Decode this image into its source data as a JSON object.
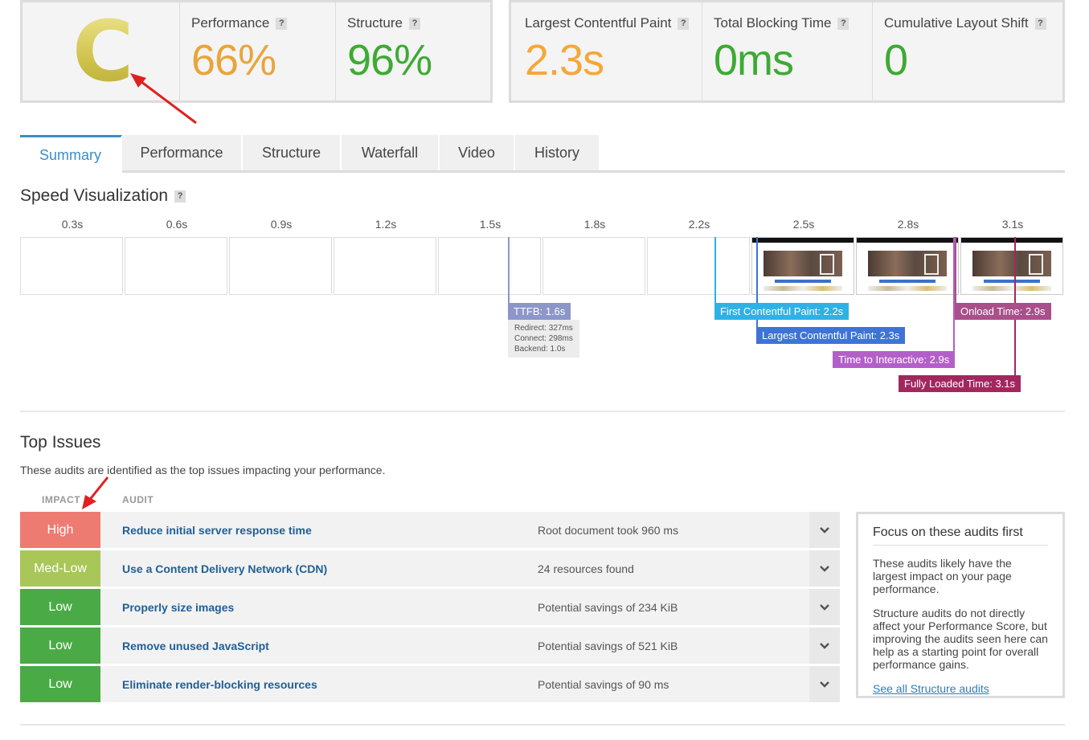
{
  "grade": {
    "letter": "C"
  },
  "scores": [
    {
      "label": "Performance",
      "help": "?",
      "value": "66%",
      "color": "#e8a53b"
    },
    {
      "label": "Structure",
      "help": "?",
      "value": "96%",
      "color": "#3eaa34"
    }
  ],
  "vitals": [
    {
      "label": "Largest Contentful Paint",
      "help": "?",
      "value": "2.3s",
      "color": "#f5a73a"
    },
    {
      "label": "Total Blocking Time",
      "help": "?",
      "value": "0ms",
      "color": "#3eaa34"
    },
    {
      "label": "Cumulative Layout Shift",
      "help": "?",
      "value": "0",
      "color": "#3eaa34"
    }
  ],
  "tabs": [
    "Summary",
    "Performance",
    "Structure",
    "Waterfall",
    "Video",
    "History"
  ],
  "active_tab": "Summary",
  "speed": {
    "title": "Speed Visualization",
    "help": "?",
    "times": [
      "0.3s",
      "0.6s",
      "0.9s",
      "1.2s",
      "1.5s",
      "1.8s",
      "2.2s",
      "2.5s",
      "2.8s",
      "3.1s"
    ],
    "markers": {
      "ttfb": {
        "label": "TTFB: 1.6s",
        "color": "#8d96c9"
      },
      "ttfb_detail": [
        "Redirect: 327ms",
        "Connect: 298ms",
        "Backend: 1.0s"
      ],
      "fcp": {
        "label": "First Contentful Paint: 2.2s",
        "color": "#2fb1e6"
      },
      "lcp": {
        "label": "Largest Contentful Paint: 2.3s",
        "color": "#3d74d6"
      },
      "tti": {
        "label": "Time to Interactive: 2.9s",
        "color": "#b35fc9"
      },
      "onload": {
        "label": "Onload Time: 2.9s",
        "color": "#a94f8a"
      },
      "fully": {
        "label": "Fully Loaded Time: 3.1s",
        "color": "#a3275f"
      }
    }
  },
  "issues_section": {
    "title": "Top Issues",
    "intro": "These audits are identified as the top issues impacting your performance.",
    "col_impact": "IMPACT",
    "col_audit": "AUDIT",
    "items": [
      {
        "impact": "High",
        "color": "#ee7b72",
        "audit": "Reduce initial server response time",
        "detail": "Root document took 960 ms"
      },
      {
        "impact": "Med-Low",
        "color": "#a9c758",
        "audit": "Use a Content Delivery Network (CDN)",
        "detail": "24 resources found"
      },
      {
        "impact": "Low",
        "color": "#4aab46",
        "audit": "Properly size images",
        "detail": "Potential savings of 234 KiB"
      },
      {
        "impact": "Low",
        "color": "#4aab46",
        "audit": "Remove unused JavaScript",
        "detail": "Potential savings of 521 KiB"
      },
      {
        "impact": "Low",
        "color": "#4aab46",
        "audit": "Eliminate render-blocking resources",
        "detail": "Potential savings of 90 ms"
      }
    ]
  },
  "focus": {
    "title": "Focus on these audits first",
    "p1": "These audits likely have the largest impact on your page performance.",
    "p2": "Structure audits do not directly affect your Performance Score, but improving the audits seen here can help as a starting point for overall performance gains.",
    "link": "See all Structure audits"
  },
  "icons": {
    "help": "question-mark",
    "expand": "chevron-down-icon"
  }
}
